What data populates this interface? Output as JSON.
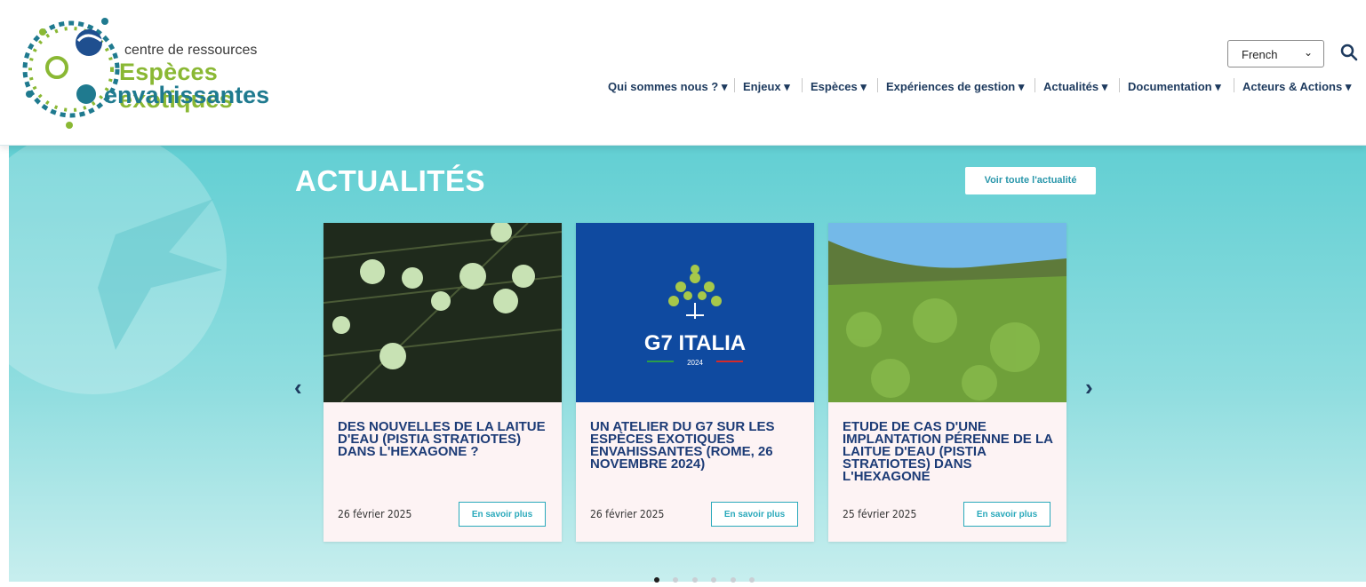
{
  "logo": {
    "line1": "centre de ressources",
    "line2": "Espèces exotiques",
    "line3": "envahissantes"
  },
  "language": {
    "selected": "French"
  },
  "nav": [
    "Qui sommes nous ?",
    "Enjeux",
    "Espèces",
    "Expériences de gestion",
    "Actualités",
    "Documentation",
    "Acteurs & Actions"
  ],
  "section": {
    "title": "ACTUALITÉS",
    "all_news": "Voir toute l'actualité"
  },
  "cards": [
    {
      "title": "DES NOUVELLES DE LA LAITUE D'EAU (PISTIA STRATIOTES) DANS L'HEXAGONE ?",
      "date": "26 février 2025",
      "more": "En savoir plus"
    },
    {
      "title": "UN ATELIER DU G7 SUR LES ESPÈCES EXOTIQUES ENVAHISSANTES (ROME, 26 NOVEMBRE 2024)",
      "date": "26 février 2025",
      "more": "En savoir plus",
      "image_text": "G7 ITALIA",
      "image_year": "2024"
    },
    {
      "title": "ETUDE DE CAS D'UNE IMPLANTATION PÉRENNE DE LA LAITUE D'EAU (PISTIA STRATIOTES) DANS L'HEXAGONE",
      "date": "25 février 2025",
      "more": "En savoir plus"
    }
  ],
  "carousel": {
    "prev_icon": "chevron-left-icon",
    "next_icon": "chevron-right-icon",
    "dots_total": 6,
    "active_dot": 1
  },
  "colors": {
    "brand_green": "#8ab834",
    "brand_teal": "#1f7a8f",
    "nav_text": "#1d3a5e",
    "accent": "#2aa9bb",
    "title_blue": "#1c3b76"
  }
}
